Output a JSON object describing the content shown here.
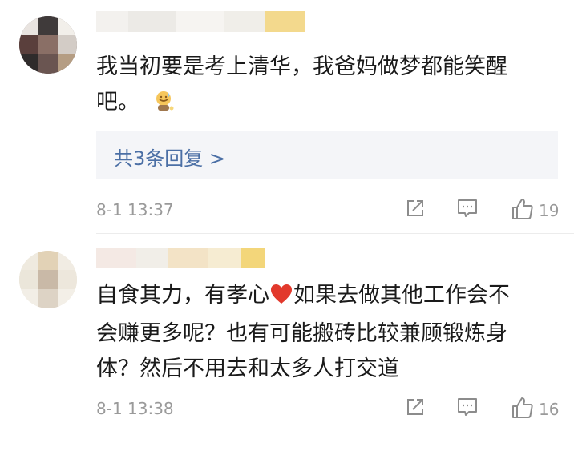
{
  "comments": [
    {
      "lines": [
        "我当初要是考上清华，我爸妈做梦都能笑醒",
        "吧。"
      ],
      "replies_label": "共3条回复 >",
      "timestamp": "8-1 13:37",
      "like_count": "19",
      "emoji_icon": "sweat-smile-emoji-icon"
    },
    {
      "line1_before": "自食其力，有孝心",
      "line1_after": "如果去做其他工作会不",
      "line2": "会赚更多呢？也有可能搬砖比较兼顾锻炼身",
      "line3": "体？然后不用去和太多人打交道",
      "timestamp": "8-1 13:38",
      "like_count": "16",
      "emoji_icon": "red-heart-icon"
    }
  ],
  "icons": {
    "share": "share-icon",
    "comment": "comment-icon",
    "like": "thumbs-up-icon"
  },
  "colors": {
    "reply_link": "#4b6fa5",
    "meta_gray": "#9a9a9a",
    "replies_bg": "#f4f5f8"
  }
}
